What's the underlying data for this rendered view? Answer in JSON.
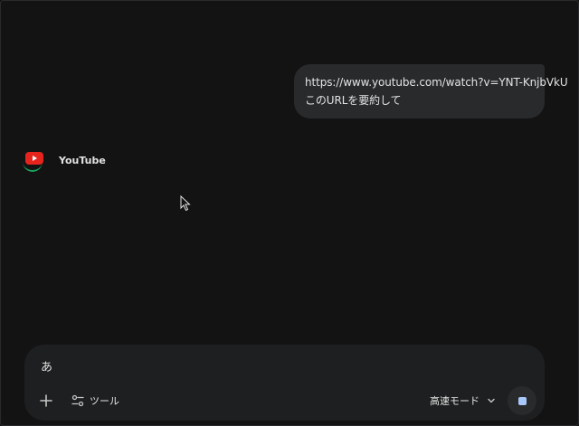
{
  "chat": {
    "user_message": {
      "url": "https://www.youtube.com/watch?v=YNT-KnjbVkU",
      "text": "このURLを要約して"
    },
    "response": {
      "source_icon": "youtube-logo-icon",
      "source_name": "YouTube"
    }
  },
  "composer": {
    "input_value": "あ",
    "add_icon": "plus-icon",
    "tools_icon": "tune-icon",
    "tools_label": "ツール",
    "mode_label": "高速モード",
    "mode_icon": "chevron-down-icon",
    "stop_icon": "stop-icon"
  },
  "colors": {
    "background": "#131314",
    "bubble": "#282a2c",
    "composer": "#1e1f20",
    "stop_accent": "#a8c7fa",
    "youtube_red": "#e5251d",
    "youtube_green": "#1ea05a"
  }
}
